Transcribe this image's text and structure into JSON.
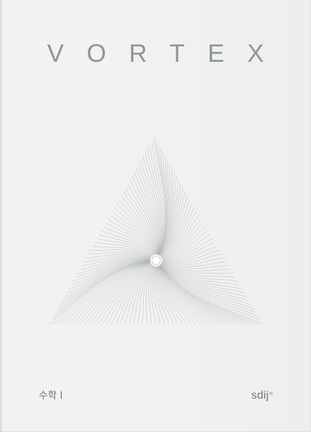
{
  "cover": {
    "title": "VORTEX",
    "subject": "수학 I",
    "brand": "sdij",
    "brand_mark": "®"
  },
  "colors": {
    "background": "#f0f0f0",
    "title": "#8f9698",
    "line": "#a8adaf",
    "footer_text": "#6f7374"
  },
  "artwork": {
    "icon": "vortex-triangle-icon",
    "center_dot": "circle"
  }
}
